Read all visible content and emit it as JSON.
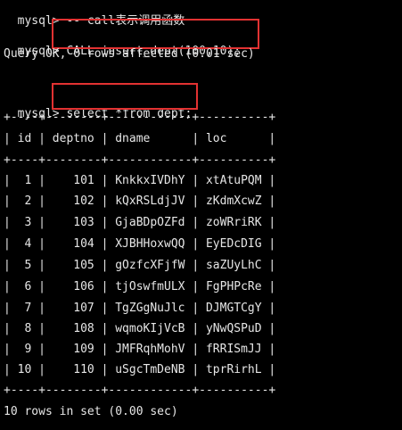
{
  "terminal": {
    "line_comment": {
      "prompt": "mysql> ",
      "text": "-- call表示调用函数"
    },
    "line_call": {
      "prompt": "mysql> ",
      "command": "CALL insert_dept(100,10);"
    },
    "line_call_result": "Query OK, 0 rows affected (0.01 sec)",
    "line_select": {
      "prompt": "mysql> ",
      "command": "select *from dept;"
    },
    "table_border": "+----+--------+------------+----------+",
    "table_header": "| id | deptno | dname      | loc      |",
    "table_rows": [
      "|  1 |    101 | KnkkxIVDhY | xtAtuPQM |",
      "|  2 |    102 | kQxRSLdjJV | zKdmXcwZ |",
      "|  3 |    103 | GjaBDpOZFd | zoWRriRK |",
      "|  4 |    104 | XJBHHoxwQQ | EyEDcDIG |",
      "|  5 |    105 | gOzfcXFjfW | saZUyLhC |",
      "|  6 |    106 | tjOswfmULX | FgPHPcRe |",
      "|  7 |    107 | TgZGgNuJlc | DJMGTCgY |",
      "|  8 |    108 | wqmoKIjVcB | yNwQSPuD |",
      "|  9 |    109 | JMFRqhMohV | fRRISmJJ |",
      "| 10 |    110 | uSgcTmDeNB | tprRirhL |"
    ],
    "line_summary": "10 rows in set (0.00 sec)"
  },
  "colors": {
    "background": "#000000",
    "text": "#e6e6e6",
    "highlight": "#e23232"
  }
}
